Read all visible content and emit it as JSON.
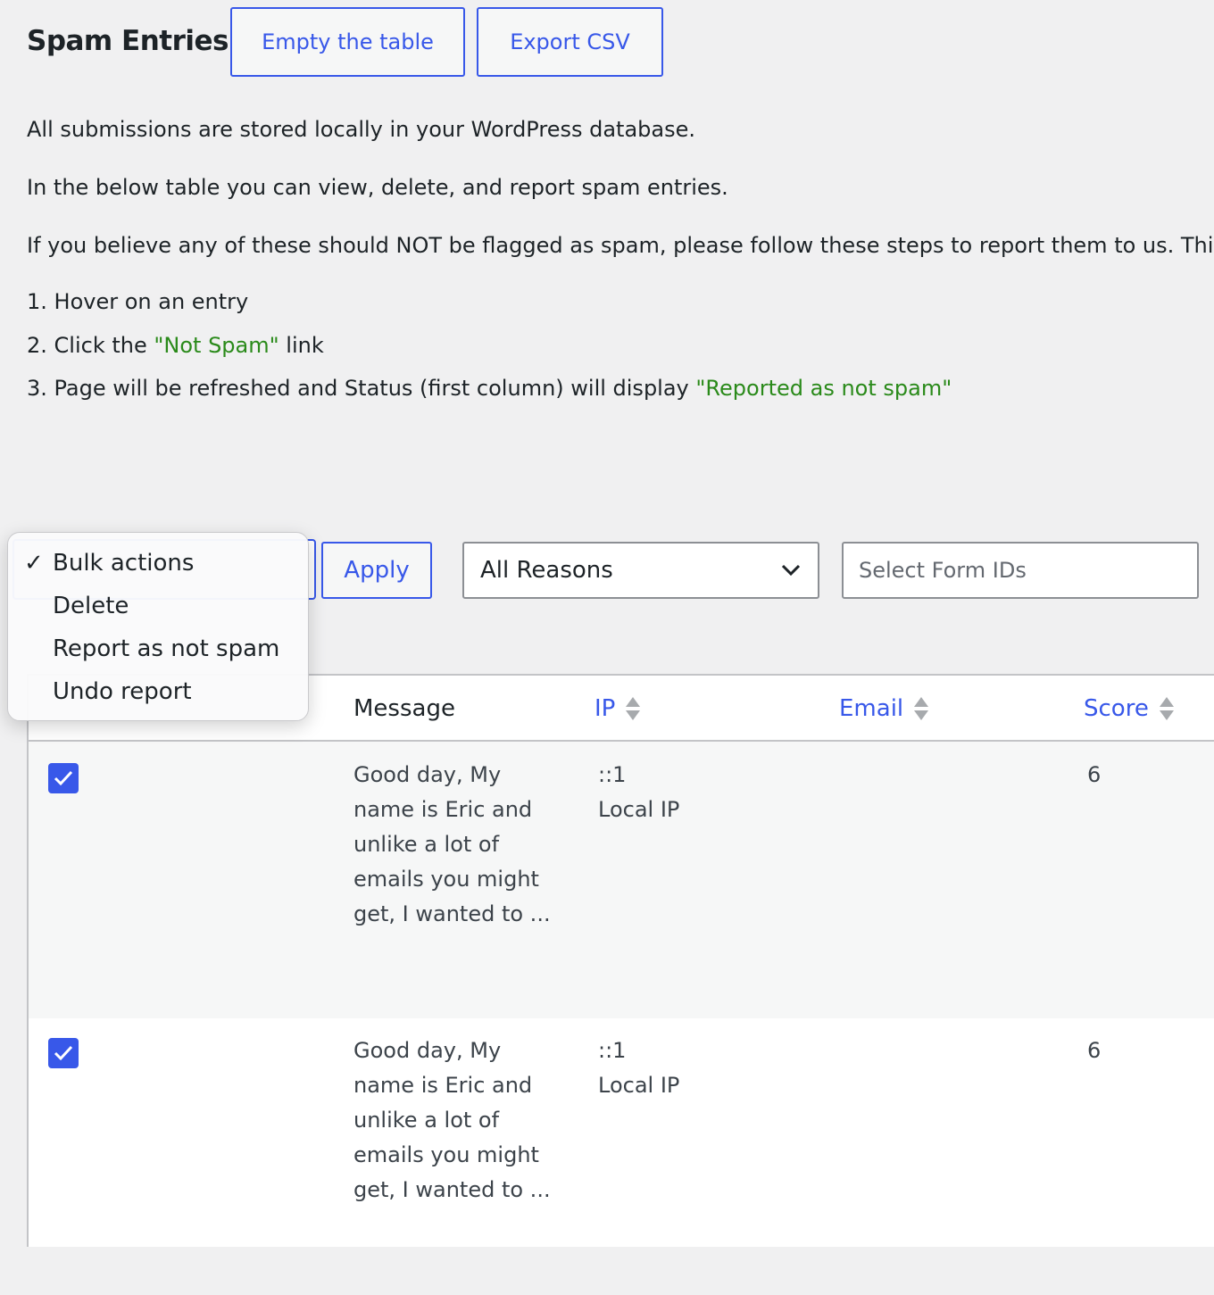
{
  "header": {
    "title": "Spam Entries",
    "empty_label": "Empty the table",
    "export_label": "Export CSV"
  },
  "intro": {
    "p1": "All submissions are stored locally in your WordPress database.",
    "p2": "In the below table you can view, delete, and report spam entries.",
    "p3": "If you believe any of these should NOT be flagged as spam, please follow these steps to report them to us. Thi",
    "steps": [
      {
        "prefix": "1. Hover on an entry",
        "highlight": "",
        "suffix": ""
      },
      {
        "prefix": "2. Click the ",
        "highlight": "\"Not Spam\"",
        "suffix": " link"
      },
      {
        "prefix": "3. Page will be refreshed and Status (first column) will display ",
        "highlight": "\"Reported as not spam\"",
        "suffix": ""
      }
    ]
  },
  "toolbar": {
    "bulk_options": [
      "Bulk actions",
      "Delete",
      "Report as not spam",
      "Undo report"
    ],
    "bulk_selected": "Bulk actions",
    "apply_label": "Apply",
    "reasons_selected": "All Reasons",
    "form_ids_placeholder": "Select Form IDs"
  },
  "table": {
    "columns": {
      "message": "Message",
      "ip": "IP",
      "email": "Email",
      "score": "Score"
    },
    "rows": [
      {
        "checked": true,
        "message": "Good day, My name is Eric and unlike a lot of emails you might get, I wanted to ...",
        "ip": "::1",
        "ip_note": "Local IP",
        "email": "",
        "score": "6"
      },
      {
        "checked": true,
        "message": "Good day, My name is Eric and unlike a lot of emails you might get, I wanted to ...",
        "ip": "::1",
        "ip_note": "Local IP",
        "email": "",
        "score": "6"
      }
    ]
  },
  "colors": {
    "accent": "#3858e9",
    "green": "#2a8a1a",
    "background": "#f0f0f1"
  }
}
